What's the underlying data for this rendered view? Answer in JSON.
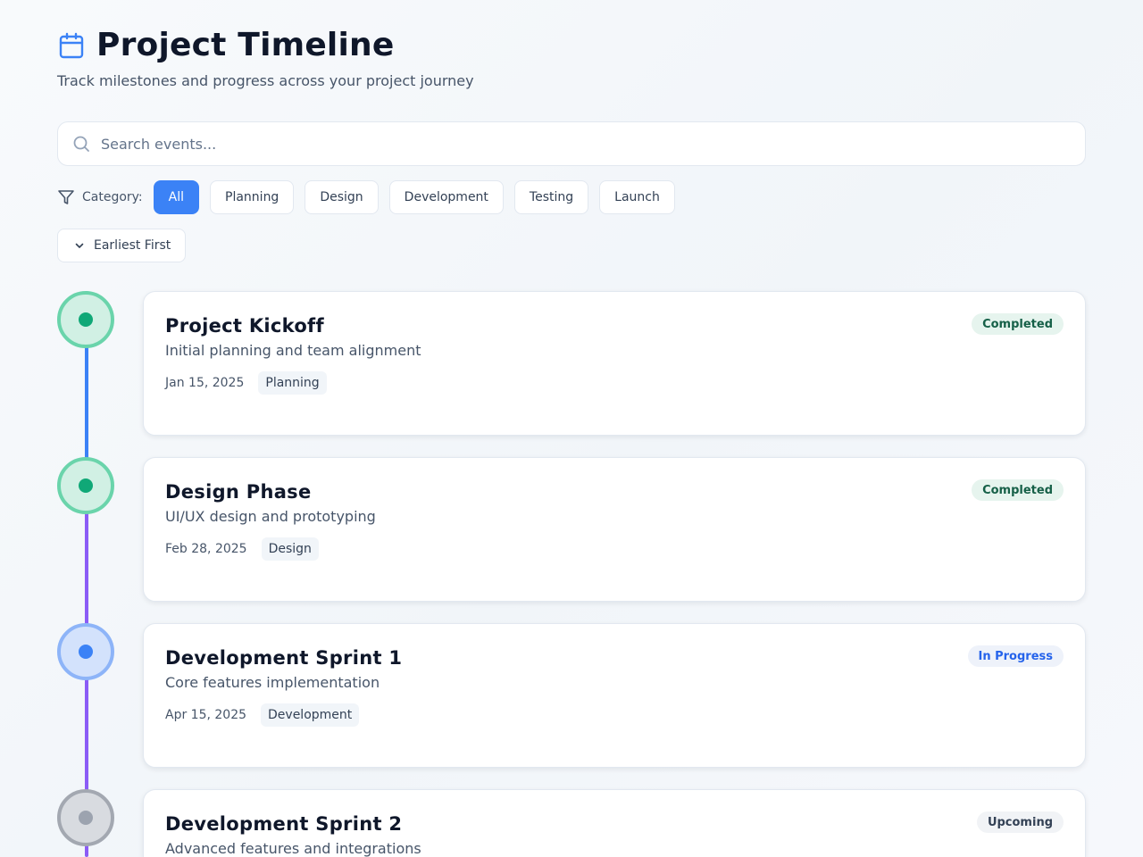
{
  "header": {
    "icon": "calendar-icon",
    "title": "Project Timeline",
    "subtitle": "Track milestones and progress across your project journey"
  },
  "search": {
    "icon": "search-icon",
    "placeholder": "Search events...",
    "value": ""
  },
  "filters": {
    "icon": "filter-icon",
    "label": "Category:",
    "options": [
      "All",
      "Planning",
      "Design",
      "Development",
      "Testing",
      "Launch"
    ],
    "selected": "All"
  },
  "sort": {
    "icon": "chevron-down-icon",
    "label": "Earliest First"
  },
  "colors": {
    "accent": "#3b82f6",
    "completed": "#10a877",
    "in_progress": "#3b82f6",
    "upcoming": "#9ca3af",
    "line_blue": "#3b82f6",
    "line_purple": "#8b5cf6"
  },
  "events": [
    {
      "title": "Project Kickoff",
      "description": "Initial planning and team alignment",
      "date": "Jan 15, 2025",
      "category": "Planning",
      "status": "Completed"
    },
    {
      "title": "Design Phase",
      "description": "UI/UX design and prototyping",
      "date": "Feb 28, 2025",
      "category": "Design",
      "status": "Completed"
    },
    {
      "title": "Development Sprint 1",
      "description": "Core features implementation",
      "date": "Apr 15, 2025",
      "category": "Development",
      "status": "In Progress"
    },
    {
      "title": "Development Sprint 2",
      "description": "Advanced features and integrations",
      "date": "",
      "category": "",
      "status": "Upcoming"
    }
  ]
}
